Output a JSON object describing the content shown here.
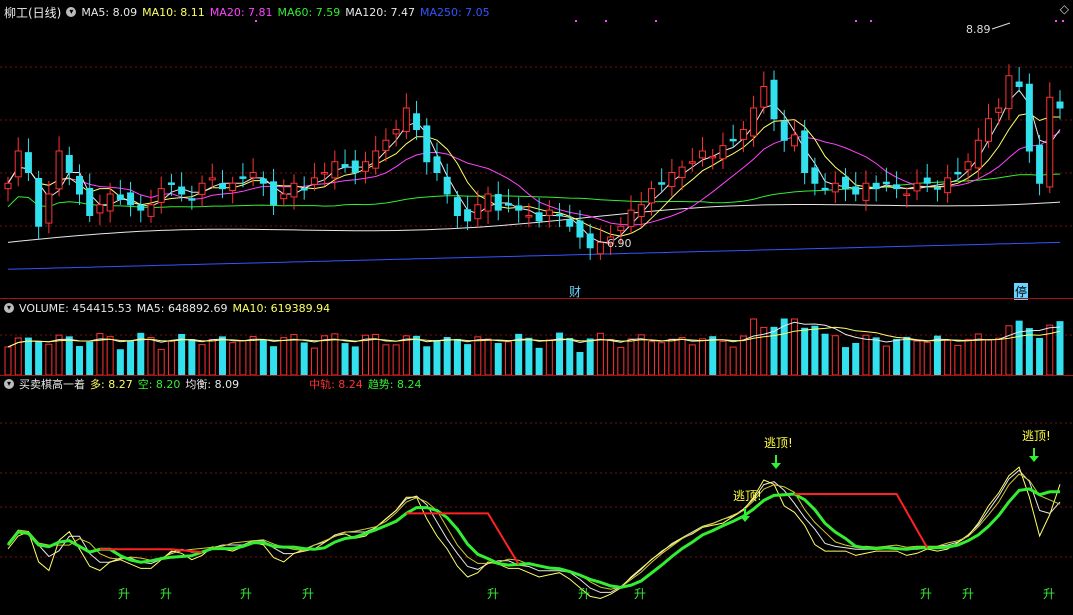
{
  "price_panel": {
    "stock_name": "柳工(日线)",
    "ma": [
      {
        "label": "MA5: 8.09",
        "color": "#e8e8e8"
      },
      {
        "label": "MA10: 8.11",
        "color": "#ffff66"
      },
      {
        "label": "MA20: 7.81",
        "color": "#ff44ff"
      },
      {
        "label": "MA60: 7.59",
        "color": "#33ee33"
      },
      {
        "label": "MA120: 7.47",
        "color": "#e8e8e8"
      },
      {
        "label": "MA250: 7.05",
        "color": "#3355ff"
      }
    ],
    "high_label": "8.89",
    "low_label": "6.90",
    "event_cai": "财",
    "event_ting": "停",
    "colors": {
      "up": "#ff3333",
      "down": "#33e0ee"
    }
  },
  "volume_panel": {
    "label": "VOLUME: 454415.53",
    "ma5": "MA5: 648892.69",
    "ma10": "MA10: 619389.94"
  },
  "indicator_panel": {
    "name": "买卖棋高一着",
    "duo": "多: 8.27",
    "kong": "空: 8.20",
    "junheng": "均衡: 8.09",
    "zhonggui": "中轨: 8.24",
    "qushi": "趋势: 8.24",
    "sheng": "升",
    "taoding": "逃顶!",
    "sheng_x": [
      118,
      160,
      240,
      302,
      487,
      578,
      634,
      920,
      962,
      1043
    ],
    "taoding_x": [
      745,
      776,
      1034
    ]
  },
  "chart_data": {
    "type": "candlestick",
    "title": "柳工(日线)",
    "ylim": [
      6.7,
      9.1
    ],
    "high": 8.89,
    "low": 6.9,
    "candles_close": [
      7.6,
      7.9,
      7.7,
      7.2,
      7.5,
      7.9,
      7.7,
      7.5,
      7.3,
      7.4,
      7.5,
      7.45,
      7.4,
      7.35,
      7.4,
      7.55,
      7.6,
      7.5,
      7.45,
      7.6,
      7.65,
      7.55,
      7.6,
      7.65,
      7.7,
      7.6,
      7.4,
      7.5,
      7.6,
      7.55,
      7.65,
      7.7,
      7.8,
      7.75,
      7.7,
      7.8,
      7.9,
      8.0,
      8.1,
      8.3,
      8.1,
      7.8,
      7.7,
      7.5,
      7.3,
      7.25,
      7.4,
      7.5,
      7.35,
      7.4,
      7.35,
      7.3,
      7.25,
      7.35,
      7.3,
      7.2,
      7.1,
      7.0,
      7.05,
      7.1,
      7.2,
      7.35,
      7.4,
      7.55,
      7.6,
      7.7,
      7.75,
      7.8,
      7.9,
      7.85,
      7.95,
      8.0,
      8.1,
      8.3,
      8.5,
      8.2,
      8.0,
      8.05,
      7.7,
      7.6,
      7.55,
      7.6,
      7.55,
      7.5,
      7.6,
      7.55,
      7.6,
      7.55,
      7.5,
      7.6,
      7.6,
      7.55,
      7.65,
      7.7,
      7.8,
      8.0,
      8.2,
      8.3,
      8.6,
      8.5,
      7.9,
      7.6,
      8.4,
      8.3
    ],
    "ma5_last": 8.09,
    "ma10_last": 8.11,
    "ma20_last": 7.81,
    "ma60_last": 7.59,
    "ma120_last": 7.47,
    "ma250_last": 7.05,
    "volume_last": 454415.53,
    "volume_ma5": 648892.69,
    "volume_ma10": 619389.94,
    "indicator": {
      "duo": 8.27,
      "kong": 8.2,
      "junheng": 8.09,
      "zhonggui": 8.24,
      "qushi": 8.24
    }
  }
}
